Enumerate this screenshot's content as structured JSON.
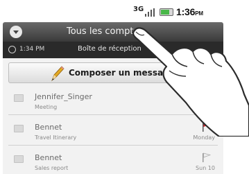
{
  "status": {
    "network": "3G",
    "time": "1:36",
    "ampm": "PM"
  },
  "header": {
    "title": "Tous les comptes",
    "title_visible": "Tous les compt"
  },
  "subbar": {
    "time": "1:34 PM",
    "folder": "Boîte de réception"
  },
  "compose": {
    "label": "Composer un message",
    "label_visible": "Composer un messa"
  },
  "messages": [
    {
      "sender": "Jennifer_Singer",
      "subject": "Meeting",
      "date": "M",
      "flag": "none"
    },
    {
      "sender": "Bennet",
      "subject": "Travel Itinerary",
      "date": "Monday",
      "flag": "red"
    },
    {
      "sender": "Bennet",
      "subject": "Sales report",
      "date": "Sun 10",
      "flag": "outline"
    }
  ],
  "colors": {
    "title_bar": "#4a4a4a",
    "sub_bar": "#2a2a2a",
    "flag": "#d9232a",
    "battery": "#49b749"
  }
}
